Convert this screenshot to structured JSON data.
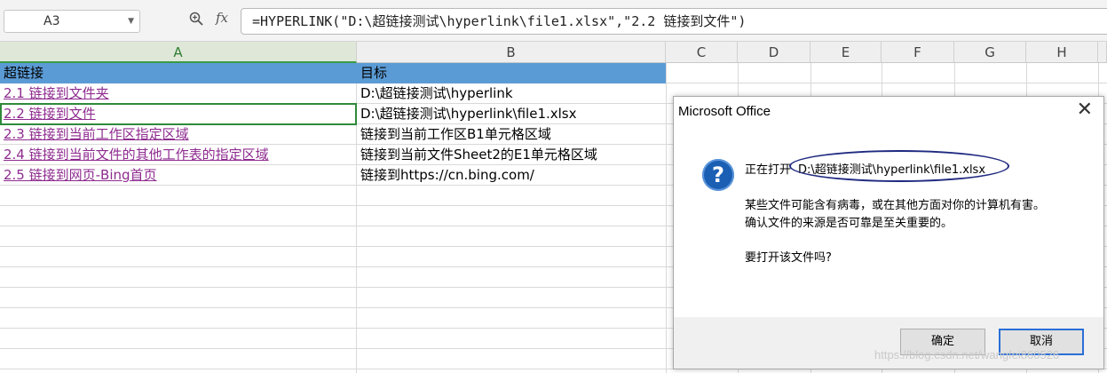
{
  "formula_bar": {
    "name_box": "A3",
    "fx_label": "fx",
    "formula": "=HYPERLINK(\"D:\\超链接测试\\hyperlink\\file1.xlsx\",\"2.2 链接到文件\")"
  },
  "columns": [
    "A",
    "B",
    "C",
    "D",
    "E",
    "F",
    "G",
    "H"
  ],
  "header_row": {
    "a": "超链接",
    "b": "目标"
  },
  "rows": [
    {
      "a": "2.1 链接到文件夹",
      "b": "D:\\超链接测试\\hyperlink"
    },
    {
      "a": "2.2 链接到文件",
      "b": "D:\\超链接测试\\hyperlink\\file1.xlsx"
    },
    {
      "a": "2.3 链接到当前工作区指定区域",
      "b": "链接到当前工作区B1单元格区域"
    },
    {
      "a": "2.4 链接到当前文件的其他工作表的指定区域",
      "b": "链接到当前文件Sheet2的E1单元格区域"
    },
    {
      "a": "2.5 链接到网页-Bing首页",
      "b": "链接到https://cn.bing.com/"
    }
  ],
  "dialog": {
    "title": "Microsoft Office",
    "opening_label": "正在打开",
    "path": "D:\\超链接测试\\hyperlink\\file1.xlsx",
    "warning_line1": "某些文件可能含有病毒，或在其他方面对你的计算机有害。",
    "warning_line2": "确认文件的来源是否可靠是至关重要的。",
    "question": "要打开该文件吗?",
    "ok_label": "确定",
    "cancel_label": "取消"
  },
  "watermark": "https://blog.csdn.net/wangfei860526",
  "colors": {
    "header_fill": "#5b9bd5",
    "link": "#8e2b8f",
    "selection": "#2f8a3b",
    "question_icon": "#1b5fb4"
  }
}
